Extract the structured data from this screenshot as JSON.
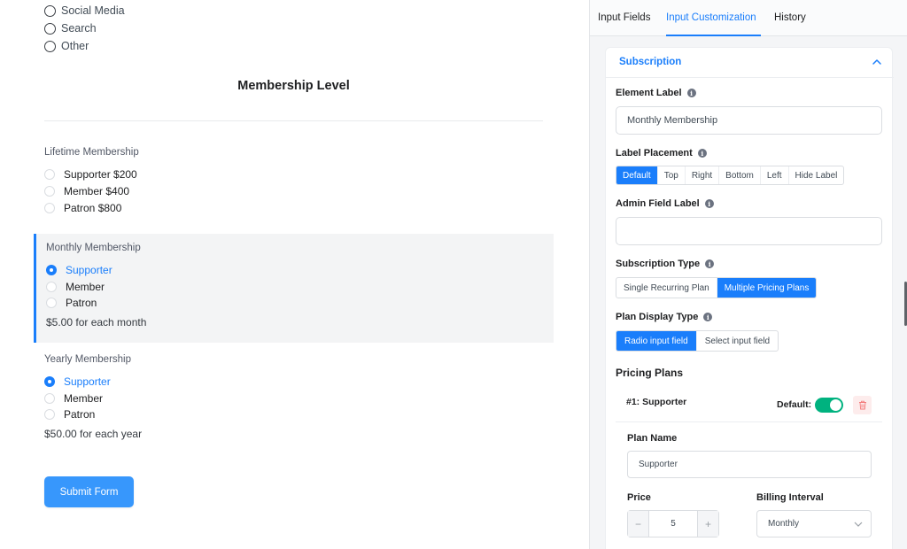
{
  "referral_options": [
    {
      "label": "Social Media"
    },
    {
      "label": "Search"
    },
    {
      "label": "Other"
    }
  ],
  "form": {
    "section_title": "Membership Level",
    "lifetime": {
      "label": "Lifetime Membership",
      "plans": [
        {
          "label": "Supporter $200",
          "checked": false
        },
        {
          "label": "Member $400",
          "checked": false
        },
        {
          "label": "Patron $800",
          "checked": false
        }
      ]
    },
    "monthly": {
      "label": "Monthly Membership",
      "plans": [
        {
          "label": "Supporter",
          "checked": true
        },
        {
          "label": "Member",
          "checked": false
        },
        {
          "label": "Patron",
          "checked": false
        }
      ],
      "price_note": "$5.00 for each month"
    },
    "yearly": {
      "label": "Yearly Membership",
      "plans": [
        {
          "label": "Supporter",
          "checked": true
        },
        {
          "label": "Member",
          "checked": false
        },
        {
          "label": "Patron",
          "checked": false
        }
      ],
      "price_note": "$50.00 for each year"
    },
    "submit_label": "Submit Form"
  },
  "panel": {
    "tabs": [
      {
        "label": "Input Fields",
        "active": false
      },
      {
        "label": "Input Customization",
        "active": true
      },
      {
        "label": "History",
        "active": false
      }
    ],
    "card_title": "Subscription",
    "element_label": {
      "label": "Element Label",
      "value": "Monthly Membership"
    },
    "label_placement": {
      "label": "Label Placement",
      "options": [
        "Default",
        "Top",
        "Right",
        "Bottom",
        "Left",
        "Hide Label"
      ],
      "selected": "Default"
    },
    "admin_field_label": {
      "label": "Admin Field Label",
      "value": ""
    },
    "subscription_type": {
      "label": "Subscription Type",
      "options": [
        "Single Recurring Plan",
        "Multiple Pricing Plans"
      ],
      "selected": "Multiple Pricing Plans"
    },
    "plan_display_type": {
      "label": "Plan Display Type",
      "options": [
        "Radio input field",
        "Select input field"
      ],
      "selected": "Radio input field"
    },
    "pricing_plans": {
      "title": "Pricing Plans",
      "plan_heading": "#1: Supporter",
      "default_label": "Default:",
      "default_on": true,
      "plan_name_label": "Plan Name",
      "plan_name_value": "Supporter",
      "price_label": "Price",
      "price_value": "5",
      "billing_interval_label": "Billing Interval",
      "billing_interval_value": "Monthly"
    }
  },
  "colors": {
    "accent": "#1a7efb",
    "submit": "#3797fc",
    "toggle_on": "#00b27f",
    "selected_bg": "#f3f4f5"
  },
  "icons": [
    "radio-icon",
    "info-icon",
    "chevron-up-icon",
    "trash-icon",
    "chevron-down-icon",
    "minus-icon",
    "plus-icon"
  ]
}
